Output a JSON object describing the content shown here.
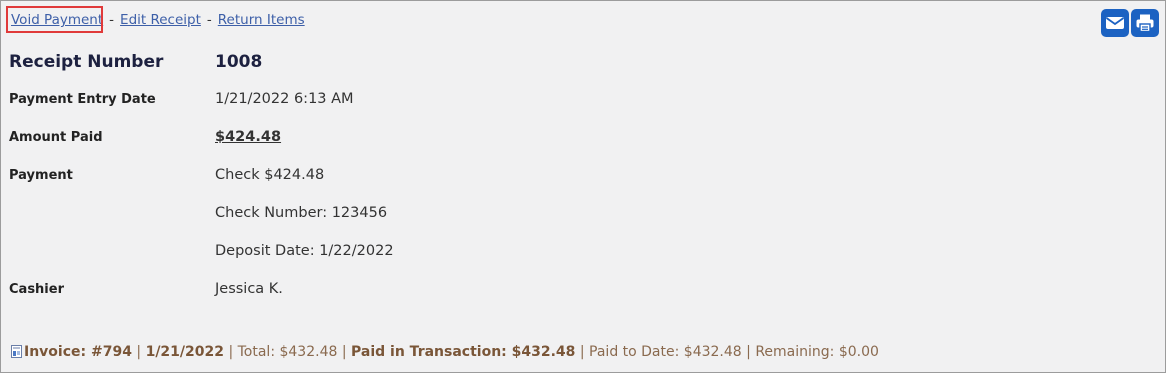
{
  "actions": {
    "void_payment": "Void Payment",
    "edit_receipt": "Edit Receipt",
    "return_items": "Return Items",
    "separator": "-"
  },
  "toolbar": {
    "email_icon": "envelope-icon",
    "print_icon": "printer-icon"
  },
  "receipt": {
    "number_label": "Receipt Number",
    "number_value": "1008",
    "entry_date_label": "Payment Entry Date",
    "entry_date_value": "1/21/2022 6:13 AM",
    "amount_label": "Amount Paid",
    "amount_value": "$424.48",
    "payment_label": "Payment",
    "payment_lines": [
      "Check $424.48",
      "Check Number: 123456",
      "Deposit Date: 1/22/2022"
    ],
    "cashier_label": "Cashier",
    "cashier_value": "Jessica K."
  },
  "invoice": {
    "icon": "document-icon",
    "invoice_text": "Invoice: #794",
    "date_text": "1/21/2022",
    "total_text": "Total: $432.48",
    "paid_in_transaction_text": "Paid in Transaction: $432.48",
    "paid_to_date_text": "Paid to Date: $432.48",
    "remaining_text": "Remaining: $0.00",
    "divider": "|"
  },
  "colors": {
    "accent": "#1c62c2",
    "link": "#3d5fa8",
    "highlight": "#e03a3a",
    "invoice_text": "#8a6a4f"
  }
}
